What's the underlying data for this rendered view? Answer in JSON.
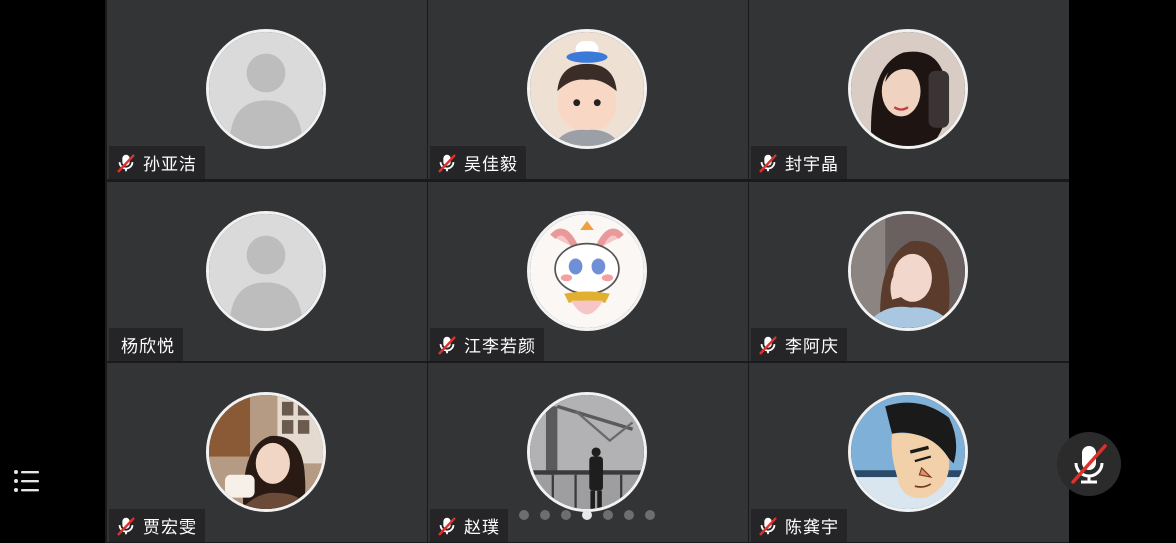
{
  "participants": [
    {
      "name": "孙亚洁",
      "muted": true,
      "avatar": "default-person-icon"
    },
    {
      "name": "吴佳毅",
      "muted": true,
      "avatar": "toddler-photo"
    },
    {
      "name": "封宇晶",
      "muted": true,
      "avatar": "woman-portrait-photo"
    },
    {
      "name": "杨欣悦",
      "muted": false,
      "avatar": "default-person-icon"
    },
    {
      "name": "江李若颜",
      "muted": true,
      "avatar": "cartoon-bunny-drawing"
    },
    {
      "name": "李阿庆",
      "muted": true,
      "avatar": "woman-selfie-photo"
    },
    {
      "name": "贾宏雯",
      "muted": true,
      "avatar": "woman-cup-photo"
    },
    {
      "name": "赵璞",
      "muted": true,
      "avatar": "balcony-silhouette-photo"
    },
    {
      "name": "陈龚宇",
      "muted": true,
      "avatar": "anime-character-drawing"
    }
  ],
  "pagination": {
    "total": 7,
    "active": 4
  },
  "controls": {
    "menu": "menu-list-icon",
    "microphone": "microphone-muted-icon"
  },
  "colors": {
    "tile": "#333436",
    "name_tag": "#252527",
    "mute_red": "#e0302c",
    "background": "#000000"
  }
}
